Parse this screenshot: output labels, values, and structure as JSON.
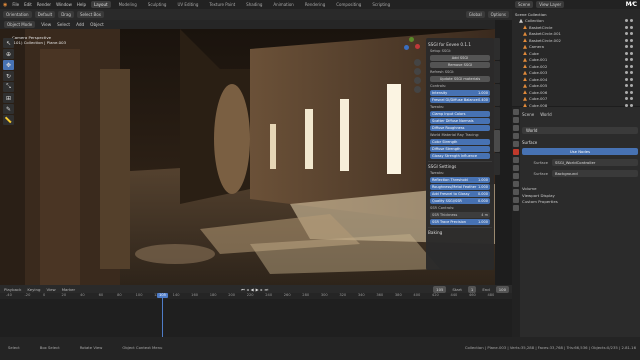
{
  "menu": [
    "File",
    "Edit",
    "Render",
    "Window",
    "Help"
  ],
  "workspaces": [
    {
      "label": "Layout",
      "active": true
    },
    {
      "label": "Modeling"
    },
    {
      "label": "Sculpting"
    },
    {
      "label": "UV Editing"
    },
    {
      "label": "Texture Paint"
    },
    {
      "label": "Shading"
    },
    {
      "label": "Animation"
    },
    {
      "label": "Rendering"
    },
    {
      "label": "Compositing"
    },
    {
      "label": "Scripting"
    }
  ],
  "scene_label": "Scene",
  "viewlayer_label": "View Layer",
  "header": {
    "mode": "Object Mode",
    "view": "View",
    "select": "Select",
    "add": "Add",
    "object": "Object",
    "orientation": "Global",
    "options": "Options",
    "editor_left": "Orientation",
    "default_label": "Default",
    "drag_label": "Drag",
    "select_box": "Select Box"
  },
  "viewport_overlay": {
    "line1": "Camera Perspective",
    "line2": "(101) Collection | Plane.003"
  },
  "npanel": {
    "title": "SSGI for Eevee 0.1.1",
    "setup_label": "Setup SSGI:",
    "add_btn": "Add SSGI",
    "remove_btn": "Remove SSGI",
    "refresh_label": "Refresh SSGI:",
    "update_btn": "Update SSGI materials",
    "controls_label": "Controls:",
    "intensity": {
      "label": "Intensity",
      "value": "1.000"
    },
    "fresnel": {
      "label": "Fresnel GI/Diffuse Balance",
      "value": "0.400"
    },
    "tweaks_label": "Tweaks:",
    "clamp": "Clamp Input Colors",
    "scatter": "Scatter Diffuse Normals",
    "diffuse_rough": "Diffuse Roughness",
    "world_label": "World Material Ray Tracing:",
    "color_strength": "Color Strength",
    "diffuse_strength": "Diffuse Strength",
    "glossy_strength": "Glossy Strength Influence",
    "settings_title": "SSGI Settings",
    "tweaks2": "Tweaks:",
    "refl_threshold": {
      "label": "Reflection Threshold",
      "value": "1.000"
    },
    "rough_feather": {
      "label": "Roughness/Metal Feather",
      "value": "1.000"
    },
    "add_fresnel": {
      "label": "Add Fresnel to Glossy",
      "value": "0.000"
    },
    "quality_label": {
      "label": "Quality SSGI/SSR",
      "value": "0.000"
    },
    "ssr_controls": "SSR Controls:",
    "ssr_thickness": {
      "label": "SSR Thickness",
      "value": "4 m"
    },
    "ssr_trace": {
      "label": "SSR Trace Precision",
      "value": "1.000"
    },
    "baking": "Baking"
  },
  "sidetabs": [
    "Item",
    "Tool",
    "View",
    "Create",
    "Edit",
    "Animation",
    "SSGI",
    "Screencast"
  ],
  "outliner": {
    "title": "Scene Collection",
    "items": [
      "Collection",
      "BasketCircle",
      "BasketCircle.001",
      "BasketCircle.002",
      "Camera",
      "Cube",
      "Cube.001",
      "Cube.002",
      "Cube.003",
      "Cube.004",
      "Cube.005",
      "Cube.006",
      "Cube.007",
      "Cube.008"
    ]
  },
  "props": {
    "scene_label": "Scene",
    "world_label": "World",
    "world_name": "World",
    "surface_section": "Surface",
    "use_nodes": "Use Nodes",
    "surface_label": "Surface",
    "surface_value": "SSGI_WorldController",
    "surface2_label": "Surface",
    "surface2_value": "Background",
    "sections": [
      "Volume",
      "Viewport Display",
      "Custom Properties"
    ]
  },
  "timeline": {
    "playback": "Playback",
    "keying": "Keying",
    "view": "View",
    "marker": "Marker",
    "current_frame": "105",
    "start_label": "Start",
    "start": "1",
    "end_label": "End",
    "end": "100",
    "playhead_frame": "105",
    "ticks": [
      "-40",
      "-20",
      "0",
      "20",
      "40",
      "60",
      "80",
      "100",
      "120",
      "140",
      "160",
      "180",
      "200",
      "220",
      "240",
      "260",
      "280",
      "300",
      "320",
      "340",
      "360",
      "380",
      "400",
      "420",
      "440",
      "460",
      "480"
    ]
  },
  "status": {
    "select": "Select",
    "box_select": "Box Select",
    "rotate": "Rotate View",
    "ctx": "Object Context Menu",
    "stats": "Collection | Plane.003 | Verts:35,288 | Faces:33,768 | Tris:66,536 | Objects:0/235 | 2.81.16"
  }
}
